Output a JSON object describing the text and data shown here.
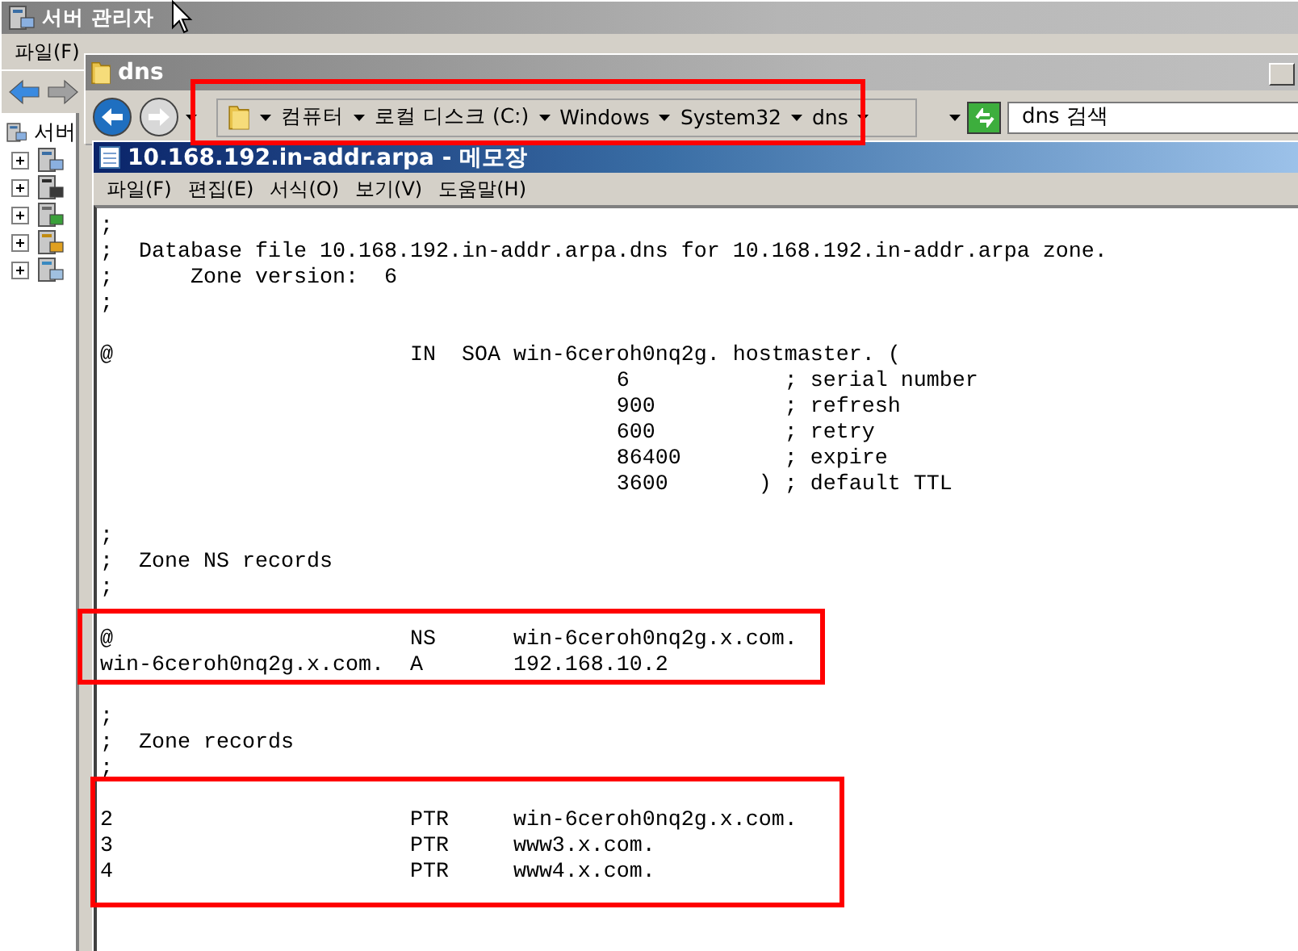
{
  "server_manager": {
    "title": "서버 관리자",
    "menu": [
      "파일(F)"
    ],
    "tree": {
      "root": "서버",
      "children": [
        {
          "expanded": false
        },
        {
          "expanded": false
        },
        {
          "expanded": false
        },
        {
          "expanded": false
        },
        {
          "expanded": false
        }
      ]
    }
  },
  "explorer": {
    "title": "dns",
    "breadcrumb": [
      "컴퓨터",
      "로컬 디스크 (C:)",
      "Windows",
      "System32",
      "dns"
    ],
    "search": {
      "placeholder": "dns 검색"
    }
  },
  "notepad": {
    "title": "10.168.192.in-addr.arpa - 메모장",
    "menu": [
      "파일(F)",
      "편집(E)",
      "서식(O)",
      "보기(V)",
      "도움말(H)"
    ],
    "lines": [
      {
        "kind": "text",
        "text": ";"
      },
      {
        "kind": "text",
        "text": ";  Database file 10.168.192.in-addr.arpa.dns for 10.168.192.in-addr.arpa zone."
      },
      {
        "kind": "text",
        "text": ";      Zone version:  6"
      },
      {
        "kind": "text",
        "text": ";"
      },
      {
        "kind": "blank"
      },
      {
        "kind": "text",
        "text": "@                       IN  SOA win-6ceroh0nq2g. hostmaster. ("
      },
      {
        "kind": "text",
        "text": "                                        6            ; serial number"
      },
      {
        "kind": "text",
        "text": "                                        900          ; refresh"
      },
      {
        "kind": "text",
        "text": "                                        600          ; retry"
      },
      {
        "kind": "text",
        "text": "                                        86400        ; expire"
      },
      {
        "kind": "text",
        "text": "                                        3600       ) ; default TTL"
      },
      {
        "kind": "blank"
      },
      {
        "kind": "text",
        "text": ";"
      },
      {
        "kind": "text",
        "text": ";  Zone NS records"
      },
      {
        "kind": "text",
        "text": ";"
      },
      {
        "kind": "blank"
      },
      {
        "kind": "text",
        "text": "@                       NS      win-6ceroh0nq2g.x.com."
      },
      {
        "kind": "text",
        "text": "win-6ceroh0nq2g.x.com.  A       192.168.10.2"
      },
      {
        "kind": "blank"
      },
      {
        "kind": "text",
        "text": ";"
      },
      {
        "kind": "text",
        "text": ";  Zone records"
      },
      {
        "kind": "text",
        "text": ";"
      },
      {
        "kind": "blank"
      },
      {
        "kind": "text",
        "text": "2                       PTR     win-6ceroh0nq2g.x.com."
      },
      {
        "kind": "text",
        "text": "3                       PTR     www3.x.com."
      },
      {
        "kind": "text",
        "text": "4                       PTR     www4.x.com."
      }
    ]
  }
}
